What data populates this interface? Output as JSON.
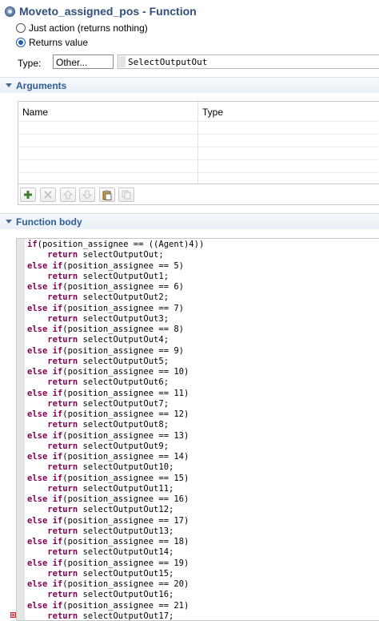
{
  "title": {
    "text": "Moveto_assigned_pos - Function",
    "icon": "function-icon"
  },
  "return_mode": {
    "options": [
      {
        "label": "Just action (returns nothing)",
        "checked": false
      },
      {
        "label": "Returns value",
        "checked": true
      }
    ]
  },
  "type_row": {
    "label": "Type:",
    "selected": "Other...",
    "value": "SelectOutputOut"
  },
  "arguments": {
    "title": "Arguments",
    "columns": [
      "Name",
      "Type"
    ],
    "rows": []
  },
  "toolbar": {
    "buttons": [
      {
        "icon": "add-icon",
        "enabled": true
      },
      {
        "icon": "delete-icon",
        "enabled": false
      },
      {
        "icon": "move-up-icon",
        "enabled": false
      },
      {
        "icon": "move-down-icon",
        "enabled": false
      },
      {
        "icon": "paste-icon",
        "enabled": true
      },
      {
        "icon": "copy-icon",
        "enabled": false
      }
    ]
  },
  "function_body": {
    "title": "Function body",
    "first_lines": [
      {
        "kw": "if",
        "rest": "(position_assignee == ((Agent)4))",
        "indent": 0
      },
      {
        "kw": "return",
        "rest": " selectOutputOut;",
        "indent": 1
      }
    ],
    "cases": [
      {
        "value": "5",
        "output": "selectOutputOut1"
      },
      {
        "value": "6",
        "output": "selectOutputOut2"
      },
      {
        "value": "7",
        "output": "selectOutputOut3"
      },
      {
        "value": "8",
        "output": "selectOutputOut4"
      },
      {
        "value": "9",
        "output": "selectOutputOut5"
      },
      {
        "value": "10",
        "output": "selectOutputOut6"
      },
      {
        "value": "11",
        "output": "selectOutputOut7"
      },
      {
        "value": "12",
        "output": "selectOutputOut8"
      },
      {
        "value": "13",
        "output": "selectOutputOut9"
      },
      {
        "value": "14",
        "output": "selectOutputOut10"
      },
      {
        "value": "15",
        "output": "selectOutputOut11"
      },
      {
        "value": "16",
        "output": "selectOutputOut12"
      },
      {
        "value": "17",
        "output": "selectOutputOut13"
      },
      {
        "value": "18",
        "output": "selectOutputOut14"
      },
      {
        "value": "19",
        "output": "selectOutputOut15"
      },
      {
        "value": "20",
        "output": "selectOutputOut16"
      },
      {
        "value": "21",
        "output": "selectOutputOut17"
      }
    ],
    "keywords": {
      "else_if": "else if",
      "return": "return"
    },
    "variable": "position_assignee"
  }
}
